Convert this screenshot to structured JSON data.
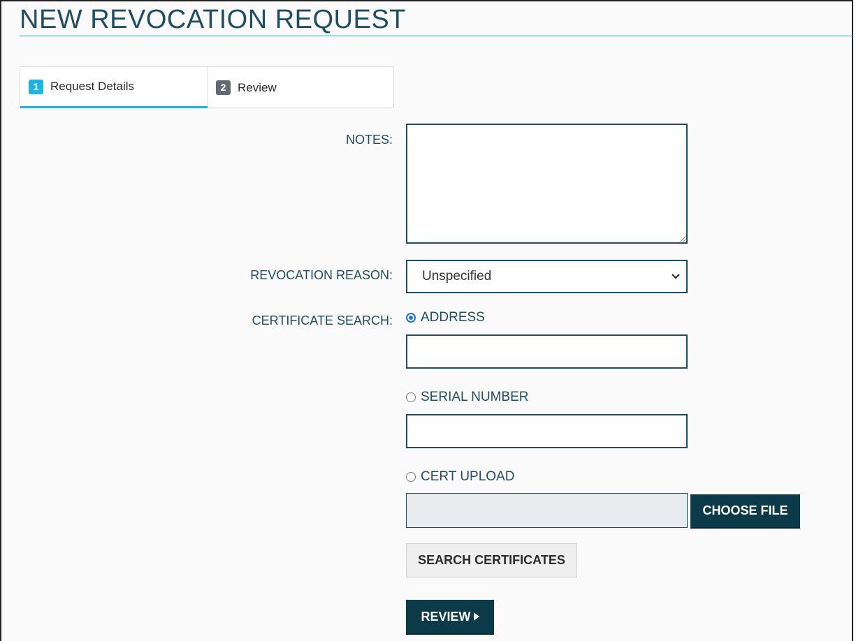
{
  "page": {
    "title": "NEW REVOCATION REQUEST"
  },
  "tabs": [
    {
      "number": "1",
      "label": "Request Details",
      "active": true
    },
    {
      "number": "2",
      "label": "Review",
      "active": false
    }
  ],
  "form": {
    "notes_label": "NOTES:",
    "notes_value": "",
    "reason_label": "REVOCATION REASON:",
    "reason_selected": "Unspecified",
    "search_label": "CERTIFICATE SEARCH:",
    "options": {
      "address": {
        "label": "ADDRESS",
        "checked": true,
        "value": ""
      },
      "serial": {
        "label": "SERIAL NUMBER",
        "checked": false,
        "value": ""
      },
      "upload": {
        "label": "CERT UPLOAD",
        "checked": false
      }
    },
    "choose_file_label": "CHOOSE FILE",
    "search_button_label": "SEARCH CERTIFICATES",
    "review_button_label": "REVIEW"
  },
  "colors": {
    "accent": "#1ab5e3",
    "primary_dark": "#0b3a49",
    "label_text": "#1f4e63"
  }
}
